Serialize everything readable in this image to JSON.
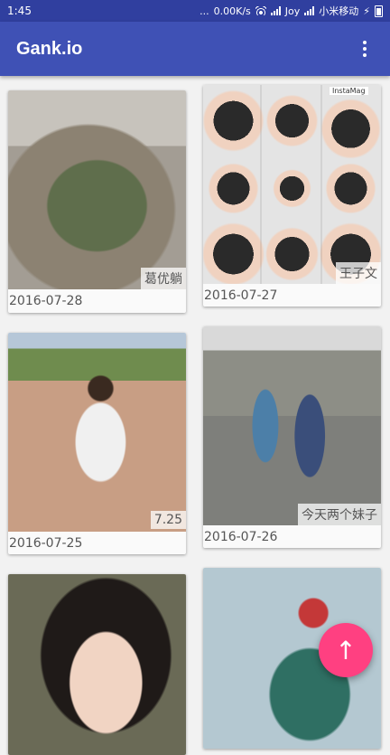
{
  "status_bar": {
    "time": "1:45",
    "dots": "...",
    "speed": "0.00K/s",
    "carrier1": "Joy",
    "carrier2": "小米移动"
  },
  "app_bar": {
    "title": "Gank.io",
    "overflow_icon": "more-vert-icon"
  },
  "cards": [
    {
      "tag": "葛优躺",
      "date": "2016-07-28"
    },
    {
      "tag": "王子文",
      "date": "2016-07-27",
      "photo_label": "InstaMag"
    },
    {
      "tag": "7.25",
      "date": "2016-07-25"
    },
    {
      "tag": "今天两个妹子",
      "date": "2016-07-26"
    },
    {
      "tag": "",
      "date": ""
    },
    {
      "tag": "",
      "date": ""
    }
  ],
  "fab": {
    "icon": "arrow-up-icon",
    "glyph": "↑",
    "color": "#ff4081"
  },
  "colors": {
    "primary": "#3f51b5",
    "primary_dark": "#303f9f"
  }
}
